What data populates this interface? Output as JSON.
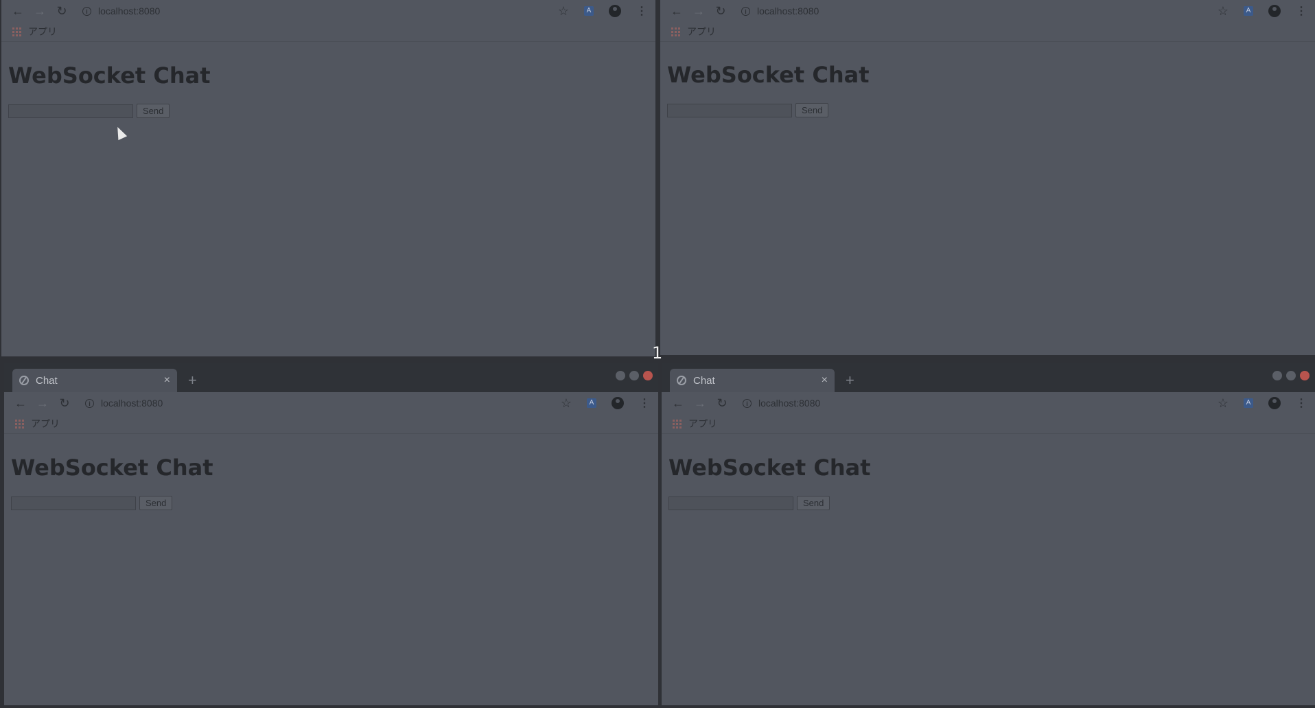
{
  "url": "localhost:8080",
  "bookmark_label": "アプリ",
  "tab_title": "Chat",
  "tab_close": "×",
  "new_tab": "+",
  "heading": "WebSocket Chat",
  "send_label": "Send",
  "input_value": "",
  "workspace_number": "1",
  "icons": {
    "back": "←",
    "forward": "→",
    "reload": "↻",
    "info": "i",
    "star": "☆",
    "translate": "A",
    "menu": "⋮"
  },
  "colors": {
    "page_bg": "#52565f",
    "tabbar_bg": "#2f3237",
    "close_red": "#b8544e"
  }
}
